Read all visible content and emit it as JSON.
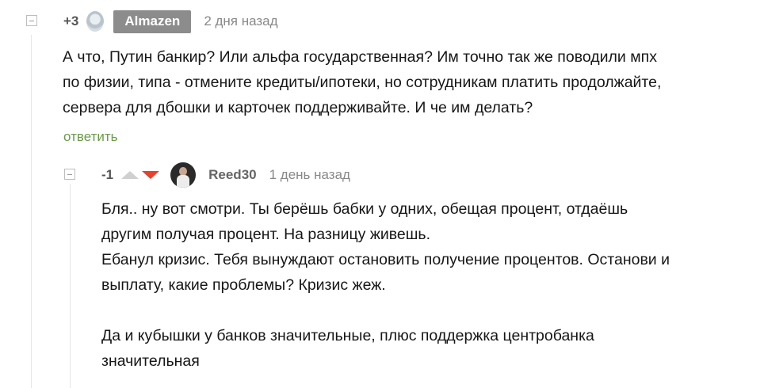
{
  "comment1": {
    "rating": "+3",
    "username": "Almazen",
    "time": "2 дня назад",
    "text": "А что, Путин банкир? Или альфа государственная? Им точно так же поводили мпх\nпо физии, типа - отмените кредиты/ипотеки, но сотрудникам платить продолжайте,\nсервера для дбошки и карточек поддерживайте. И че им делать?",
    "reply_label": "ответить"
  },
  "comment2": {
    "rating": "-1",
    "username": "Reed30",
    "time": "1 день назад",
    "text": "Бля.. ну вот смотри. Ты берёшь бабки у одних, обещая процент, отдаёшь\nдругим получая процент. На разницу живешь.\nЕбанул кризис. Тебя вынуждают остановить получение процентов. Останови и\nвыплату, какие проблемы? Кризис жеж.\n\nДа и кубышки у банков значительные, плюс поддержка центробанка\nзначительная"
  },
  "colors": {
    "reply_link": "#6a9a4a",
    "downvote_active": "#e8412c",
    "username_badge": "#8c8c8c"
  },
  "icons": [
    "collapse-icon",
    "avatar",
    "upvote-icon",
    "downvote-icon"
  ]
}
